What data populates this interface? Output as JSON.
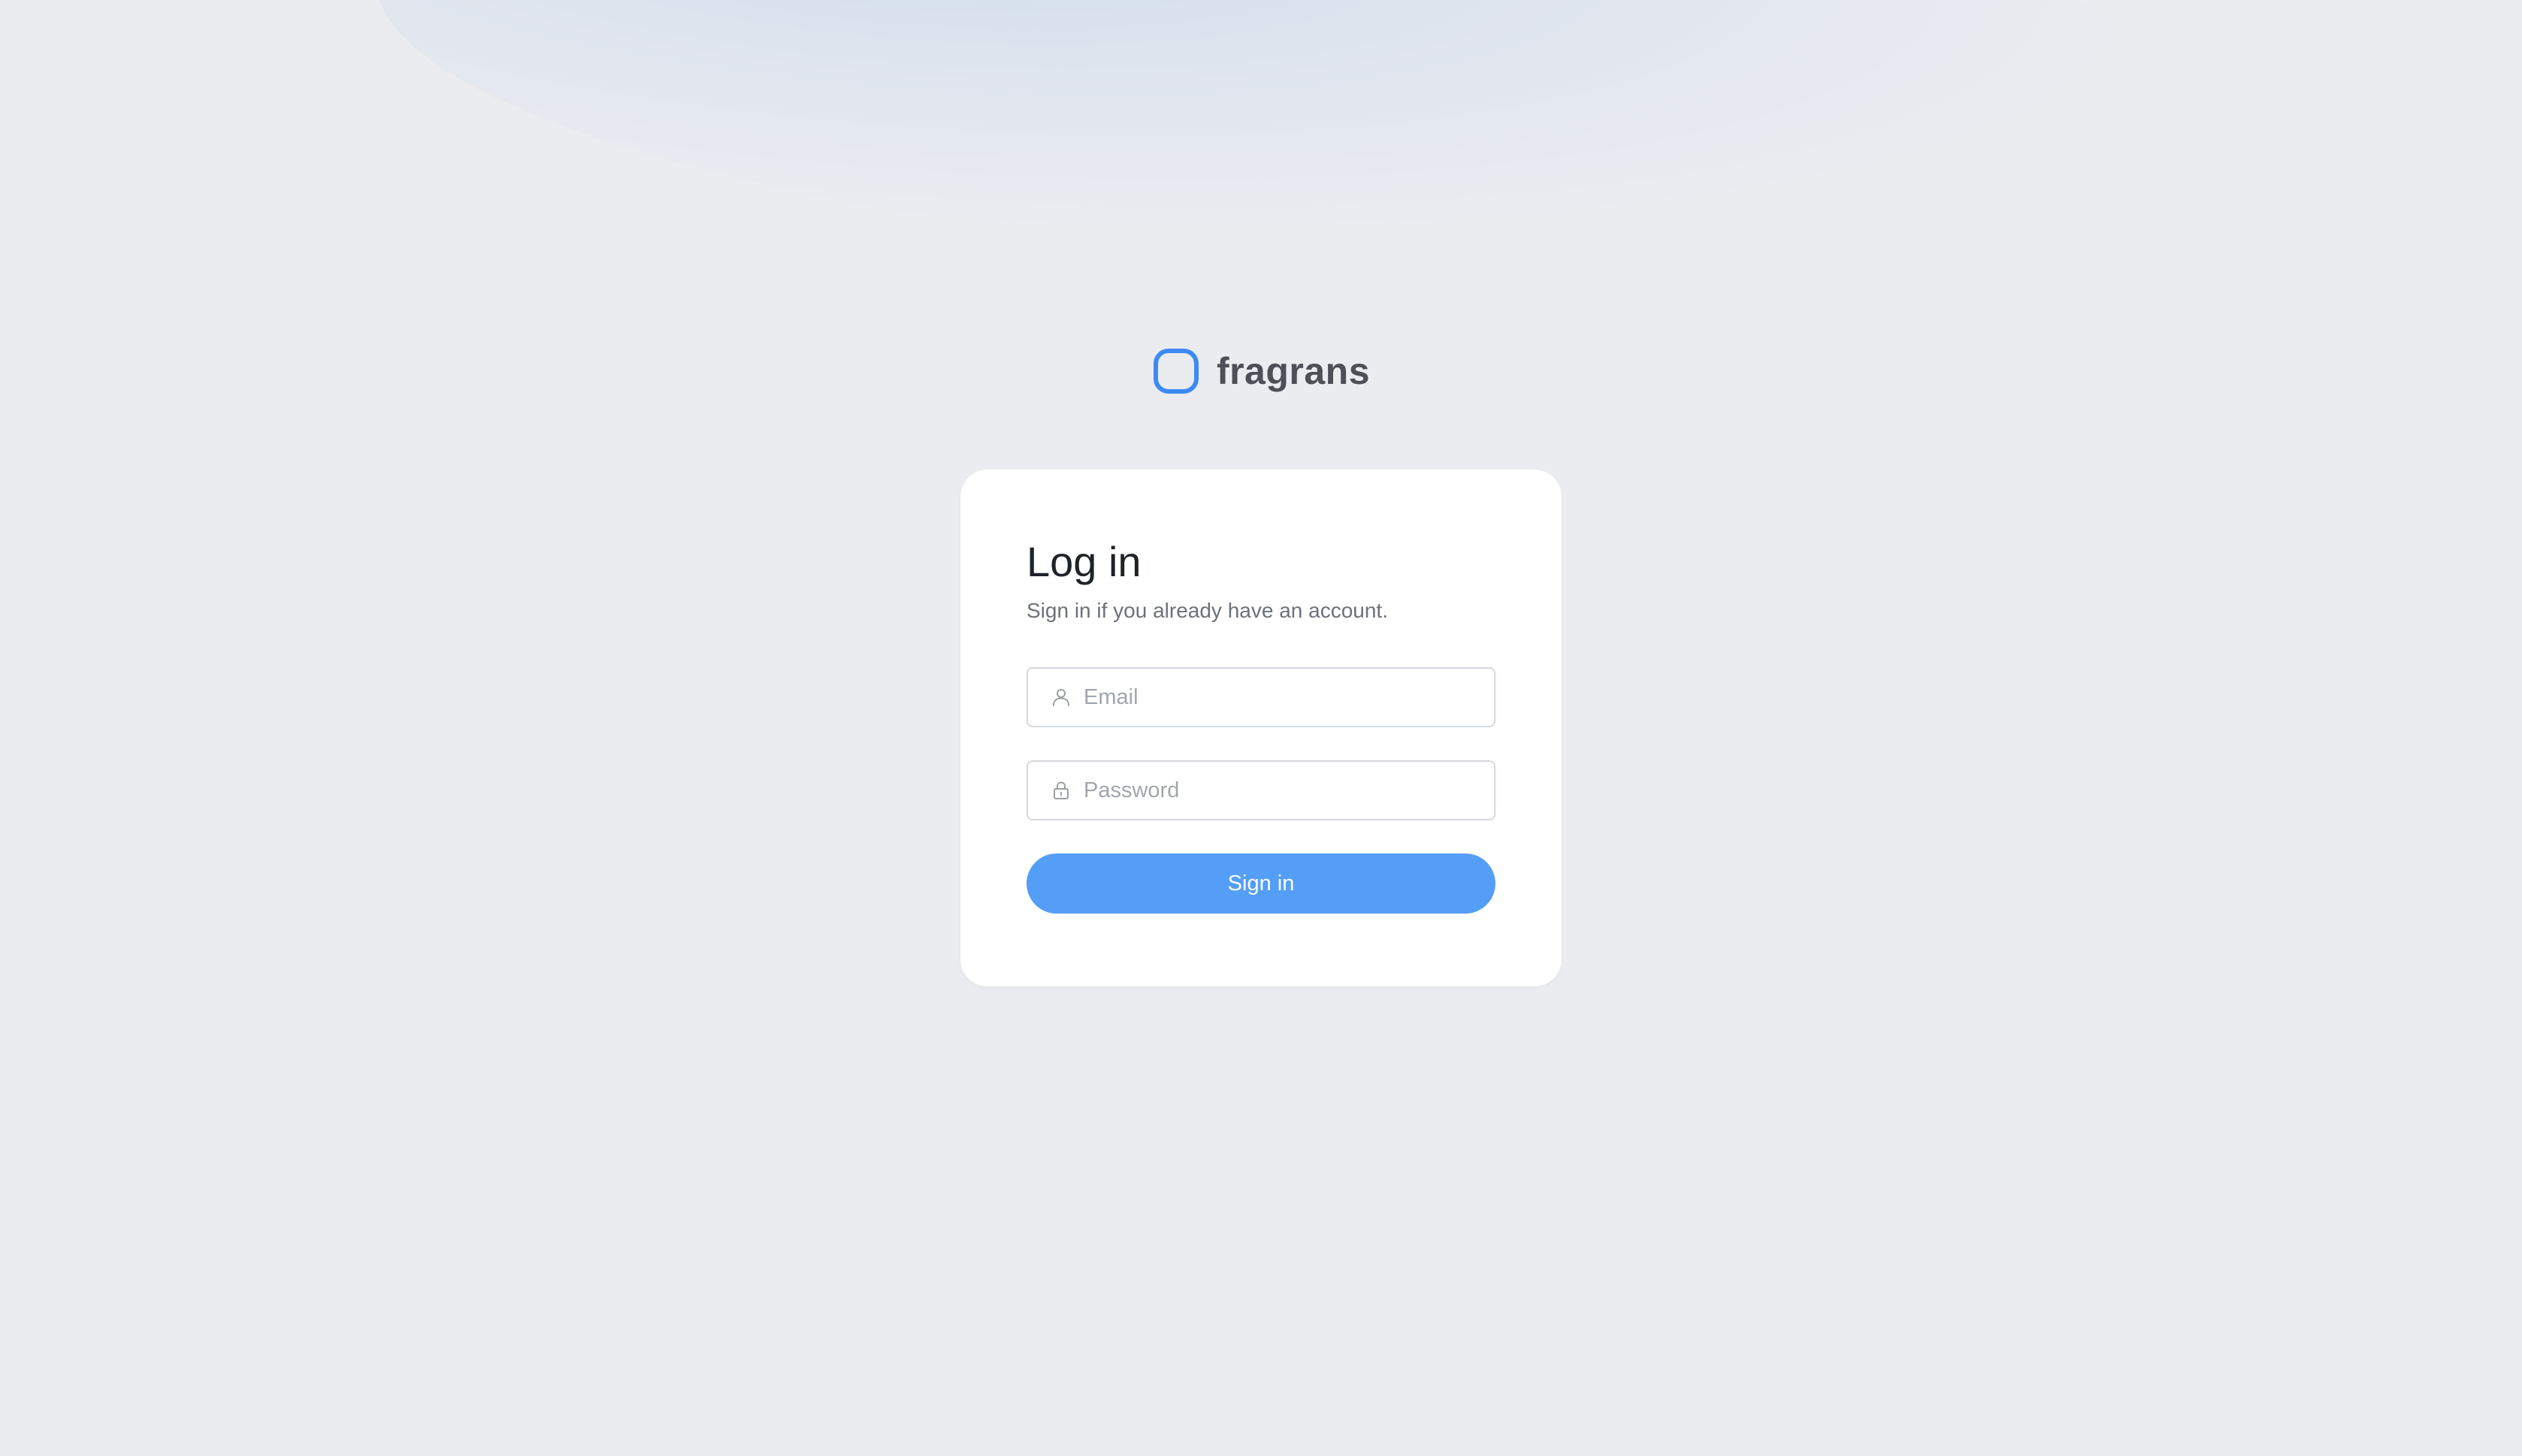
{
  "brand": {
    "name": "fragrans",
    "logo_icon": "rounded-square-logo-icon",
    "accent_color": "#3d8bf2"
  },
  "login": {
    "title": "Log in",
    "subtitle": "Sign in if you already have an account.",
    "email": {
      "value": "",
      "placeholder": "Email",
      "icon": "user-icon"
    },
    "password": {
      "value": "",
      "placeholder": "Password",
      "icon": "lock-icon"
    },
    "submit_label": "Sign in",
    "button_color": "#559ef7"
  }
}
